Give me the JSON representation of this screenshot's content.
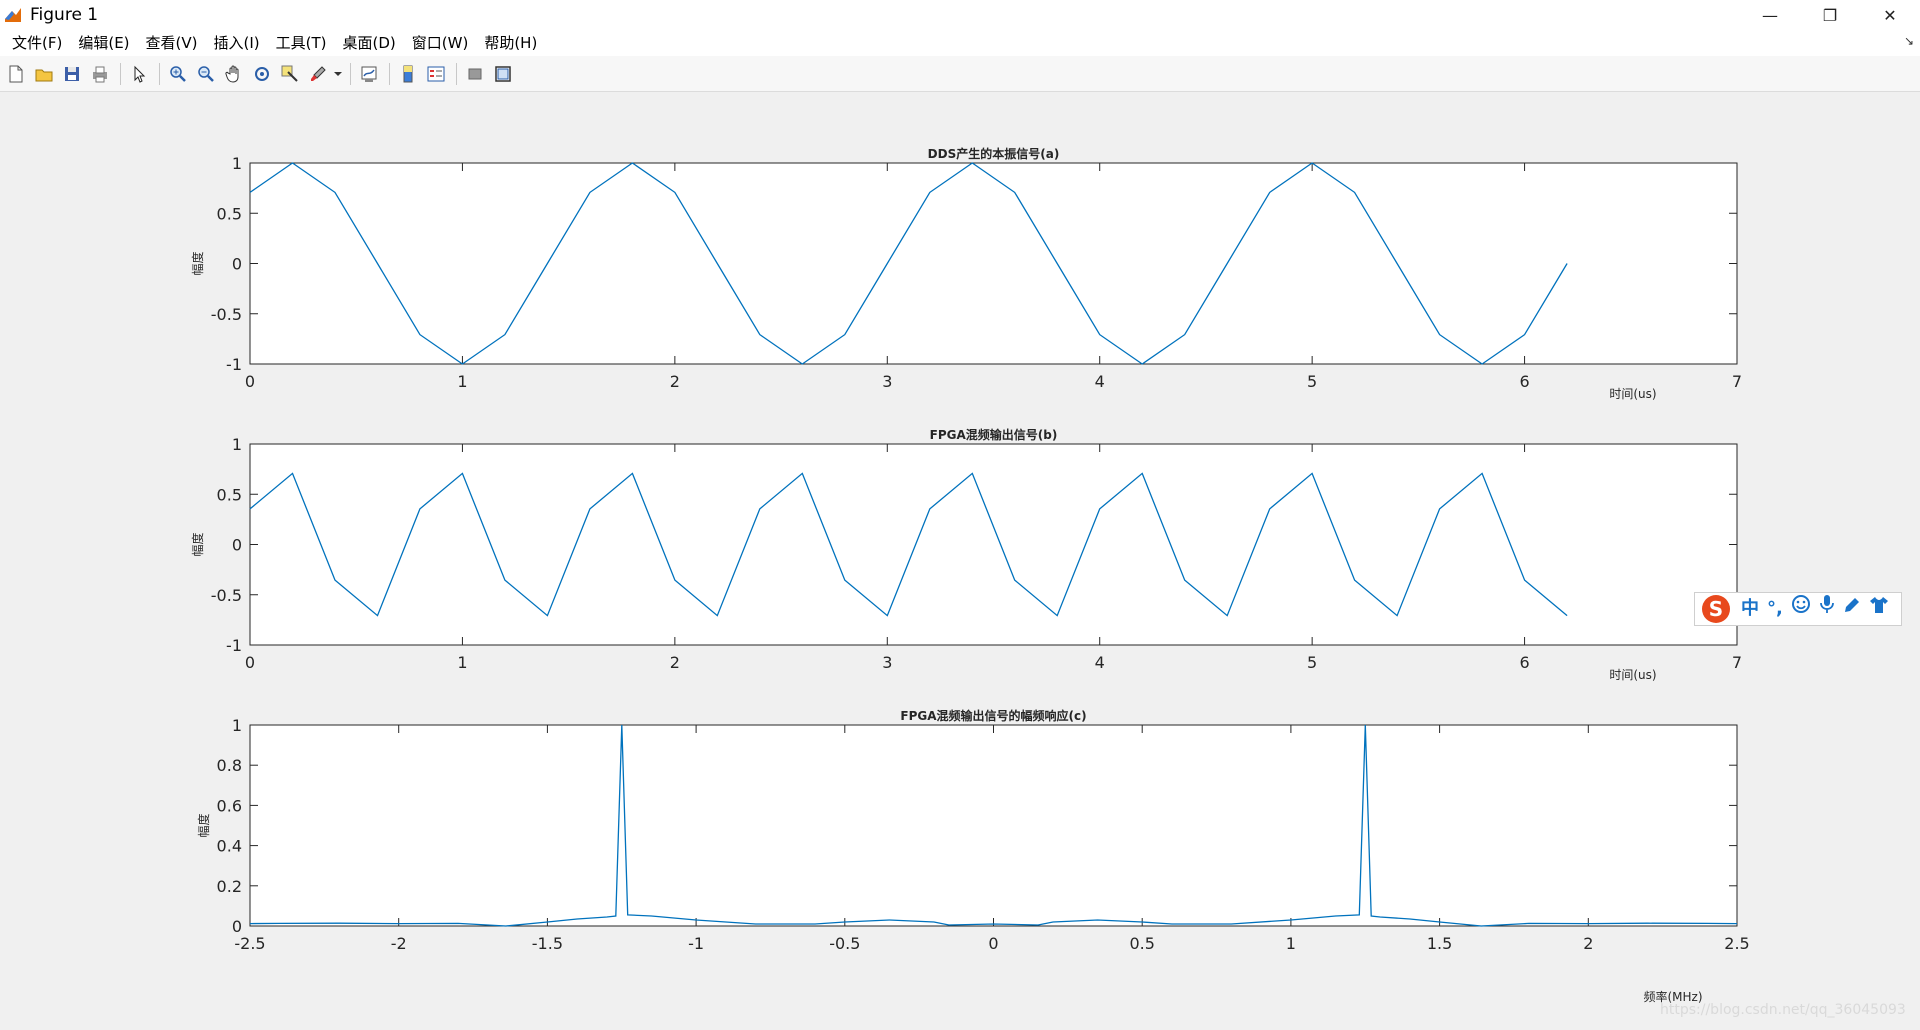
{
  "window": {
    "title": "Figure 1",
    "controls": {
      "minimize": "—",
      "restore": "❐",
      "close": "✕"
    }
  },
  "menu": [
    {
      "label": "文件(F)"
    },
    {
      "label": "编辑(E)"
    },
    {
      "label": "查看(V)"
    },
    {
      "label": "插入(I)"
    },
    {
      "label": "工具(T)"
    },
    {
      "label": "桌面(D)"
    },
    {
      "label": "窗口(W)"
    },
    {
      "label": "帮助(H)"
    }
  ],
  "menu_dock_arrow": "↘",
  "toolbar": {
    "buttons": [
      "new-figure-icon",
      "open-file-icon",
      "save-icon",
      "print-icon",
      "pointer-icon",
      "zoom-in-icon",
      "zoom-out-icon",
      "pan-hand-icon",
      "rotate-3d-icon",
      "data-cursor-icon",
      "brush-icon",
      "link-plot-icon",
      "colorbar-icon",
      "legend-icon",
      "hide-plot-tools-icon",
      "show-plot-tools-icon"
    ]
  },
  "colors": {
    "line": "#0072bd",
    "axes_bg": "#ffffff",
    "figure_bg": "#f0f0f0"
  },
  "ime": {
    "logo": "S",
    "mode": "中",
    "punct": "°,",
    "icons": [
      "smiley-icon",
      "microphone-icon",
      "pen-icon",
      "shirt-icon"
    ]
  },
  "watermark": "https://blog.csdn.net/qq_36045093",
  "chart_data": [
    {
      "type": "line",
      "title": "DDS产生的本振信号(a)",
      "xlabel": "时间(us)",
      "ylabel": "幅度",
      "xlim": [
        0,
        7
      ],
      "ylim": [
        -1,
        1
      ],
      "xticks": [
        "0",
        "1",
        "2",
        "3",
        "4",
        "5",
        "6",
        "7"
      ],
      "yticks": [
        "-1",
        "-0.5",
        "0",
        "0.5",
        "1"
      ],
      "x": [
        0,
        0.2,
        0.4,
        0.6,
        0.8,
        1.0,
        1.2,
        1.4,
        1.6,
        1.8,
        2.0,
        2.2,
        2.4,
        2.6,
        2.8,
        3.0,
        3.2,
        3.4,
        3.6,
        3.8,
        4.0,
        4.2,
        4.4,
        4.6,
        4.8,
        5.0,
        5.2,
        5.4,
        5.6,
        5.8,
        6.0,
        6.2
      ],
      "y": [
        0.707,
        1,
        0.707,
        0,
        -0.707,
        -1,
        -0.707,
        0,
        0.707,
        1,
        0.707,
        0,
        -0.707,
        -1,
        -0.707,
        0,
        0.707,
        1,
        0.707,
        0,
        -0.707,
        -1,
        -0.707,
        0,
        0.707,
        1,
        0.707,
        0,
        -0.707,
        -1,
        -0.707,
        0
      ]
    },
    {
      "type": "line",
      "title": "FPGA混频输出信号(b)",
      "xlabel": "时间(us)",
      "ylabel": "幅度",
      "xlim": [
        0,
        7
      ],
      "ylim": [
        -1,
        1
      ],
      "xticks": [
        "0",
        "1",
        "2",
        "3",
        "4",
        "5",
        "6",
        "7"
      ],
      "yticks": [
        "-1",
        "-0.5",
        "0",
        "0.5",
        "1"
      ],
      "x": [
        0,
        0.2,
        0.4,
        0.6,
        0.8,
        1.0,
        1.2,
        1.4,
        1.6,
        1.8,
        2.0,
        2.2,
        2.4,
        2.6,
        2.8,
        3.0,
        3.2,
        3.4,
        3.6,
        3.8,
        4.0,
        4.2,
        4.4,
        4.6,
        4.8,
        5.0,
        5.2,
        5.4,
        5.6,
        5.8,
        6.0,
        6.2
      ],
      "y": [
        0.354,
        0.707,
        -0.354,
        -0.707,
        0.354,
        0.707,
        -0.354,
        -0.707,
        0.354,
        0.707,
        -0.354,
        -0.707,
        0.354,
        0.707,
        -0.354,
        -0.707,
        0.354,
        0.707,
        -0.354,
        -0.707,
        0.354,
        0.707,
        -0.354,
        -0.707,
        0.354,
        0.707,
        -0.354,
        -0.707,
        0.354,
        0.707,
        -0.354,
        -0.707
      ]
    },
    {
      "type": "line",
      "title": "FPGA混频输出信号的幅频响应(c)",
      "xlabel": "频率(MHz)",
      "ylabel": "幅度",
      "xlim": [
        -2.5,
        2.5
      ],
      "ylim": [
        0,
        1
      ],
      "xticks": [
        "-2.5",
        "-2",
        "-1.5",
        "-1",
        "-0.5",
        "0",
        "0.5",
        "1",
        "1.5",
        "2",
        "2.5"
      ],
      "yticks": [
        "0",
        "0.2",
        "0.4",
        "0.6",
        "0.8",
        "1"
      ],
      "x": [
        -2.5,
        -2.4,
        -2.2,
        -2.0,
        -1.8,
        -1.64,
        -1.5,
        -1.4,
        -1.3,
        -1.27,
        -1.25,
        -1.23,
        -1.15,
        -1.0,
        -0.8,
        -0.6,
        -0.5,
        -0.35,
        -0.2,
        -0.15,
        0,
        0.15,
        0.2,
        0.35,
        0.5,
        0.6,
        0.8,
        1.0,
        1.15,
        1.23,
        1.25,
        1.27,
        1.3,
        1.4,
        1.5,
        1.64,
        1.8,
        2.0,
        2.2,
        2.4,
        2.5
      ],
      "y": [
        0.012,
        0.013,
        0.014,
        0.012,
        0.013,
        0.0,
        0.02,
        0.035,
        0.045,
        0.05,
        1.0,
        0.055,
        0.05,
        0.03,
        0.01,
        0.01,
        0.02,
        0.03,
        0.02,
        0.005,
        0.01,
        0.005,
        0.02,
        0.03,
        0.02,
        0.01,
        0.01,
        0.03,
        0.05,
        0.055,
        1.0,
        0.05,
        0.045,
        0.035,
        0.02,
        0.0,
        0.013,
        0.012,
        0.014,
        0.013,
        0.012
      ]
    }
  ]
}
